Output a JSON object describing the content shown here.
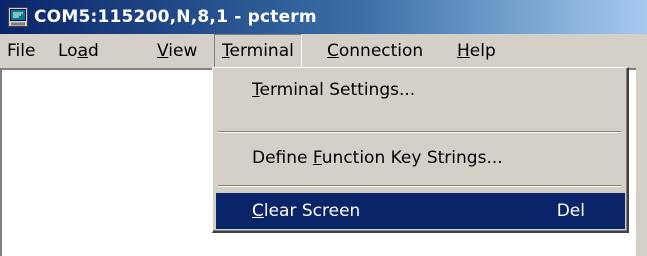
{
  "window": {
    "title": "COM5:115200,N,8,1 - pcterm",
    "icon": "terminal-app-icon"
  },
  "menubar": {
    "items": [
      {
        "id": "file",
        "pre": "File",
        "ul": "",
        "post": ""
      },
      {
        "id": "load",
        "pre": "Lo",
        "ul": "a",
        "post": "d"
      },
      {
        "id": "view",
        "pre": "",
        "ul": "V",
        "post": "iew"
      },
      {
        "id": "terminal",
        "pre": "",
        "ul": "T",
        "post": "erminal",
        "open": true
      },
      {
        "id": "connection",
        "pre": "",
        "ul": "C",
        "post": "onnection"
      },
      {
        "id": "help",
        "pre": "",
        "ul": "H",
        "post": "elp"
      }
    ]
  },
  "terminal_menu": {
    "items": [
      {
        "pre": "",
        "ul": "T",
        "post": "erminal Settings...",
        "shortcut": ""
      },
      {
        "pre": "Define ",
        "ul": "F",
        "post": "unction Key Strings...",
        "shortcut": ""
      },
      {
        "pre": "",
        "ul": "C",
        "post": "lear Screen",
        "shortcut": "Del",
        "highlighted": true
      }
    ]
  },
  "colors": {
    "titlebar_start": "#0a246a",
    "titlebar_end": "#a6caf0",
    "highlight": "#0a246a",
    "face": "#d4d0c8",
    "client_bg": "#ffffff"
  }
}
